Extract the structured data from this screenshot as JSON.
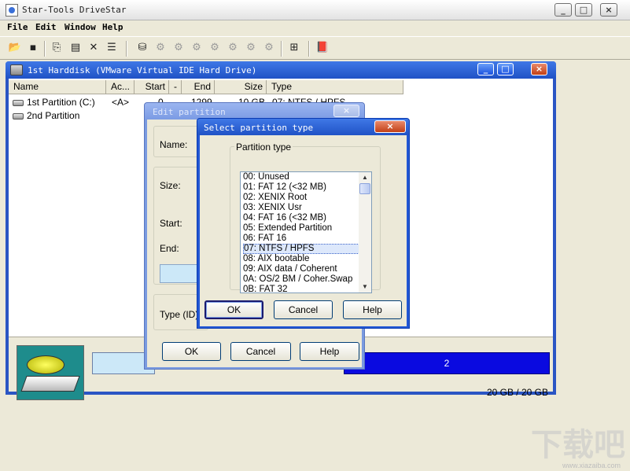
{
  "app": {
    "title": "Star-Tools DriveStar",
    "caption_buttons": [
      "_",
      "□",
      "×"
    ]
  },
  "menu": [
    "File",
    "Edit",
    "Window",
    "Help"
  ],
  "toolbar": [
    "open-icon",
    "save-icon",
    "paste-icon",
    "properties-icon",
    "delete-icon",
    "info-icon",
    "disk-tool-icon",
    "gear-disabled-icon",
    "gear-disabled-icon",
    "gear-disabled-icon",
    "gear-disabled-icon",
    "gear-disabled-icon",
    "gear-disabled-icon",
    "gear-disabled-icon",
    "tree-icon",
    "book-icon"
  ],
  "harddisk": {
    "title": "1st Harddisk (VMware Virtual IDE Hard Drive)",
    "columns": [
      "Name",
      "Ac...",
      "Start",
      "-",
      "End",
      "Size",
      "Type"
    ],
    "rows": [
      {
        "name": "1st Partition (C:)",
        "active": "<A>",
        "start": "0",
        "end": "1299",
        "size": "10 GB",
        "type": "07: NTFS / HPFS"
      },
      {
        "name": "2nd Partition",
        "active": "",
        "start": "",
        "end": "",
        "size": "",
        "type": ""
      }
    ],
    "bar_label": "2",
    "capacity": "20 GB / 20 GB"
  },
  "edit_dialog": {
    "title": "Edit partition",
    "name_label": "Name:",
    "size_label": "Size:",
    "start_label": "Start:",
    "end_label": "End:",
    "type_label": "Type (ID):",
    "ok": "OK",
    "cancel": "Cancel",
    "help": "Help"
  },
  "select_dialog": {
    "title": "Select partition type",
    "group_label": "Partition type",
    "items": [
      "00: Unused",
      "01: FAT 12 (<32 MB)",
      "02: XENIX Root",
      "03: XENIX Usr",
      "04: FAT 16 (<32 MB)",
      "05: Extended Partition",
      "06: FAT 16",
      "07: NTFS / HPFS",
      "08: AIX bootable",
      "09: AIX data / Coherent",
      "0A: OS/2 BM / Coher.Swap",
      "0B: FAT 32"
    ],
    "selected": "07: NTFS / HPFS",
    "ok": "OK",
    "cancel": "Cancel",
    "help": "Help",
    "close": "×"
  },
  "watermark": {
    "text": "下载吧",
    "url": "www.xiazaiba.com"
  },
  "colors": {
    "title_blue": "#2052c6",
    "partition_blue": "#0a0ae0",
    "partition_light": "#cce8f8"
  }
}
